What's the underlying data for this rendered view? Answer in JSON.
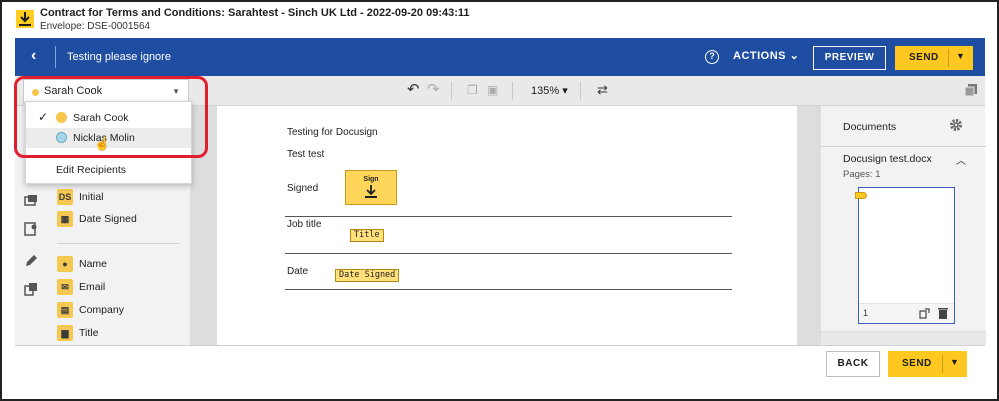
{
  "header": {
    "doc_title": "Contract for Terms and Conditions: Sarahtest - Sinch UK Ltd - 2022-09-20 09:43:11",
    "envelope": "Envelope: DSE-0001564",
    "envelope_name": "Testing please ignore",
    "actions_label": "ACTIONS",
    "preview_label": "PREVIEW",
    "send_label": "SEND",
    "accent_color": "#1e4da1",
    "send_color": "#ffc820"
  },
  "toolbar": {
    "selected_recipient": "Sarah Cook",
    "zoom": "135%"
  },
  "recipient_dropdown": {
    "items": [
      {
        "name": "Sarah Cook",
        "color": "#f7c64a",
        "selected": true
      },
      {
        "name": "Nicklas Molin",
        "color": "#a8d6ea",
        "selected": false
      }
    ],
    "edit_label": "Edit Recipients"
  },
  "fields": {
    "group1": [
      {
        "icon": "initial-icon",
        "badge": "DS",
        "label": "Initial"
      },
      {
        "icon": "calendar-icon",
        "label": "Date Signed"
      }
    ],
    "group2": [
      {
        "icon": "person-icon",
        "label": "Name"
      },
      {
        "icon": "envelope-icon",
        "label": "Email"
      },
      {
        "icon": "building-icon",
        "label": "Company"
      },
      {
        "icon": "briefcase-icon",
        "label": "Title"
      }
    ]
  },
  "document": {
    "line1": "Testing for Docusign",
    "line2": "Test test",
    "signed_label": "Signed",
    "sign_tag": "Sign",
    "job_title_label": "Job title",
    "title_tag": "Title",
    "date_label": "Date",
    "date_tag": "Date Signed"
  },
  "right_panel": {
    "title": "Documents",
    "file_name": "Docusign test.docx",
    "pages": "Pages: 1",
    "page_number": "1"
  },
  "footer": {
    "back_label": "BACK",
    "send_label": "SEND"
  }
}
